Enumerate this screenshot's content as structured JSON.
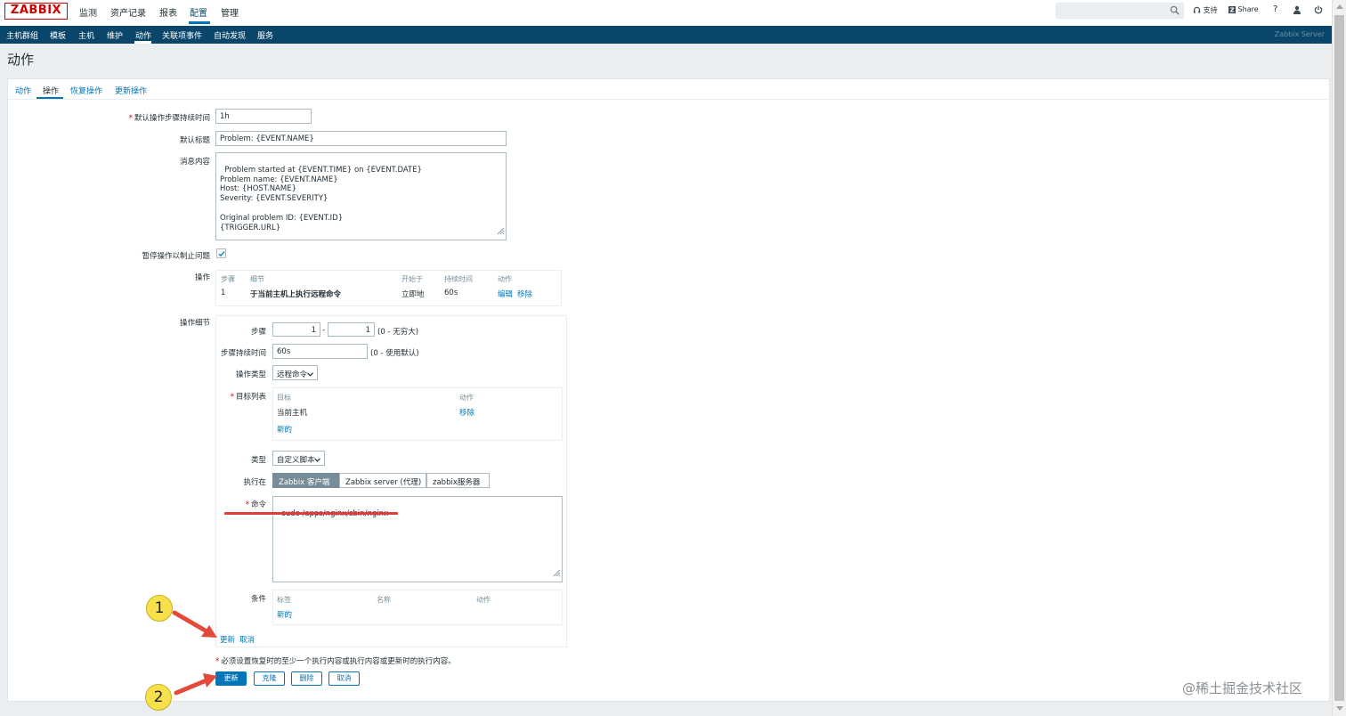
{
  "header": {
    "logo": "ZABBIX",
    "menu": [
      {
        "label": "监测"
      },
      {
        "label": "资产记录"
      },
      {
        "label": "报表"
      },
      {
        "label": "配置"
      },
      {
        "label": "管理"
      }
    ],
    "support_label": "支持",
    "share_label": "Share",
    "help_label": "?",
    "subnav": [
      {
        "label": "主机群组"
      },
      {
        "label": "模板"
      },
      {
        "label": "主机"
      },
      {
        "label": "维护"
      },
      {
        "label": "动作"
      },
      {
        "label": "关联项事件"
      },
      {
        "label": "自动发现"
      },
      {
        "label": "服务"
      }
    ],
    "server_name": "Zabbix Server"
  },
  "page": {
    "title": "动作",
    "tabs": [
      {
        "label": "动作"
      },
      {
        "label": "操作"
      },
      {
        "label": "恢复操作"
      },
      {
        "label": "更新操作"
      }
    ]
  },
  "form": {
    "default_step_duration_label": "默认操作步骤持续时间",
    "default_step_duration_value": "1h",
    "default_subject_label": "默认标题",
    "default_subject_value": "Problem: {EVENT.NAME}",
    "message_label": "消息内容",
    "message_value": "Problem started at {EVENT.TIME} on {EVENT.DATE}\nProblem name: {EVENT.NAME}\nHost: {HOST.NAME}\nSeverity: {EVENT.SEVERITY}\n\nOriginal problem ID: {EVENT.ID}\n{TRIGGER.URL}",
    "pause_label": "暂停操作以制止问题",
    "pause_checked": true,
    "operations_label": "操作",
    "operations_table": {
      "headers": [
        "步骤",
        "细节",
        "开始于",
        "持续时间",
        "动作"
      ],
      "rows": [
        {
          "step": "1",
          "details": "于当前主机上执行远程命令",
          "start": "立即地",
          "duration": "60s",
          "edit": "编辑",
          "remove": "移除"
        }
      ]
    },
    "op_details_label": "操作细节",
    "op_details": {
      "steps_label": "步骤",
      "step_from": "1",
      "step_sep": "-",
      "step_to": "1",
      "step_hint": "(0 - 无穷大)",
      "step_duration_label": "步骤持续时间",
      "step_duration_value": "60s",
      "step_duration_hint": "(0 - 使用默认)",
      "op_type_label": "操作类型",
      "op_type_value": "远程命令",
      "target_list_label": "目标列表",
      "target_headers": [
        "目标",
        "动作"
      ],
      "target_rows": [
        {
          "target": "当前主机",
          "action": "移除"
        }
      ],
      "target_new": "新的",
      "type_label": "类型",
      "type_value": "自定义脚本",
      "execute_on_label": "执行在",
      "execute_on_options": [
        {
          "label": "Zabbix 客户端"
        },
        {
          "label": "Zabbix server (代理)"
        },
        {
          "label": "zabbix服务器"
        }
      ],
      "command_label": "命令",
      "command_value": "sudo /apps/nginx/sbin/nginx",
      "conditions_label": "条件",
      "conditions_headers": [
        "标签",
        "名称",
        "动作"
      ],
      "conditions_new": "新的",
      "update_link": "更新",
      "cancel_link": "取消"
    },
    "warning": "必须设置恢复时的至少一个执行内容或执行内容或更新时的执行内容。",
    "buttons": {
      "update": "更新",
      "clone": "克隆",
      "delete": "删除",
      "cancel": "取消"
    }
  },
  "annotations": {
    "callout_1": "1",
    "callout_2": "2",
    "underline_color": "#e03c3c",
    "arrow_color": "#e34a3a"
  },
  "watermark": "@稀土掘金技术社区",
  "colors": {
    "brand_red": "#d40000",
    "nav_blue": "#0a466a",
    "link_blue": "#0275b8"
  }
}
